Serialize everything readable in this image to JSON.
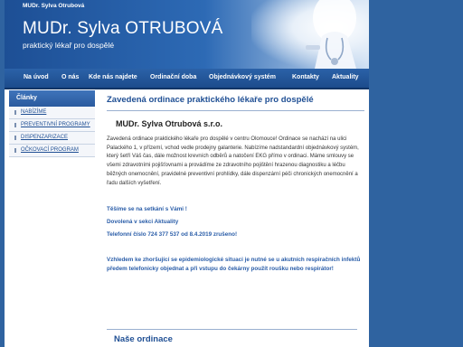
{
  "header": {
    "top_name": "MUDr. Sylva Otrubová",
    "title": "MUDr. Sylva OTRUBOVÁ",
    "subtitle": "praktický lékař pro dospělé"
  },
  "nav": {
    "items": [
      "Na úvod",
      "O nás",
      "Kde nás najdete",
      "Ordinační doba",
      "Objednávkový systém",
      "Kontakty",
      "Aktuality"
    ]
  },
  "sidebar": {
    "heading": "Články",
    "items": [
      "NABÍZÍME",
      "PREVENTIVNÍ PROGRAMY",
      "DISPENZARIZACE",
      "OČKOVACÍ PROGRAM"
    ]
  },
  "main": {
    "title": "Zavedená ordinace praktického lékaře pro dospělé",
    "org_name": "MUDr. Sylva Otrubová s.r.o.",
    "intro": "Zavedená ordinace praktického lékaře pro dospělé v centru Olomouce! Ordinace se nachází na ulici Palackého 1, v přízemí, vchod vedle prodejny galanterie. Nabízíme nadstandardní objednávkový systém, který šetří Váš čas, dále možnost krevních odběrů a natočení EKG přímo v ordinaci. Máme smlouvy se všemi zdravotními pojišťovnami a provádíme ze zdravotního pojištění hrazenou diagnostiku a léčbu běžných onemocnění, pravidelné preventivní prohlídky, dále dispenzární péči chronických onemocnění a řadu dalších vyšetření.",
    "welcome": "Těšíme se na setkání s Vámi !",
    "vacation": "Dovolená v sekci Aktuality",
    "phone_note": "Telefonní číslo 724 377 537 od 8.4.2019 zrušeno!",
    "covid_note": "Vzhledem ke zhoršující se epidemiologické situaci je nutné se u akutních respiračních infektů předem telefonicky objednat a při vstupu do čekárny použít roušku nebo respirátor!",
    "section_title": "Naše ordinace"
  }
}
